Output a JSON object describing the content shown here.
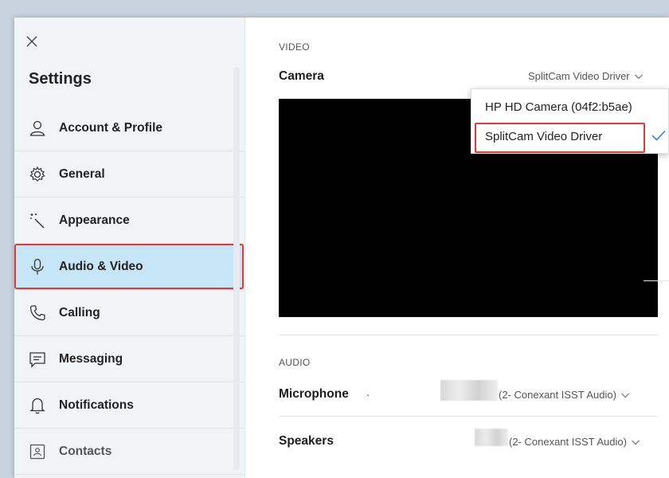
{
  "sidebar": {
    "title": "Settings",
    "items": [
      {
        "label": "Account & Profile",
        "icon": "person-icon"
      },
      {
        "label": "General",
        "icon": "gear-icon"
      },
      {
        "label": "Appearance",
        "icon": "magic-wand-icon"
      },
      {
        "label": "Audio & Video",
        "icon": "microphone-icon",
        "active": true
      },
      {
        "label": "Calling",
        "icon": "phone-icon"
      },
      {
        "label": "Messaging",
        "icon": "message-icon"
      },
      {
        "label": "Notifications",
        "icon": "bell-icon"
      },
      {
        "label": "Contacts",
        "icon": "contact-card-icon"
      }
    ]
  },
  "video": {
    "section": "VIDEO",
    "camera_label": "Camera",
    "camera_value": "SplitCam Video Driver",
    "options": [
      "HP HD Camera (04f2:b5ae)",
      "SplitCam Video Driver"
    ],
    "selected_index": 1
  },
  "audio": {
    "section": "AUDIO",
    "microphone_label": "Microphone",
    "microphone_dot": ".",
    "microphone_value": "(2- Conexant ISST Audio)",
    "speakers_label": "Speakers",
    "speakers_value": "(2- Conexant ISST Audio)"
  },
  "colors": {
    "active_bg": "#c6e6f7",
    "highlight_border": "#e53935",
    "check_color": "#2b7cd3"
  }
}
